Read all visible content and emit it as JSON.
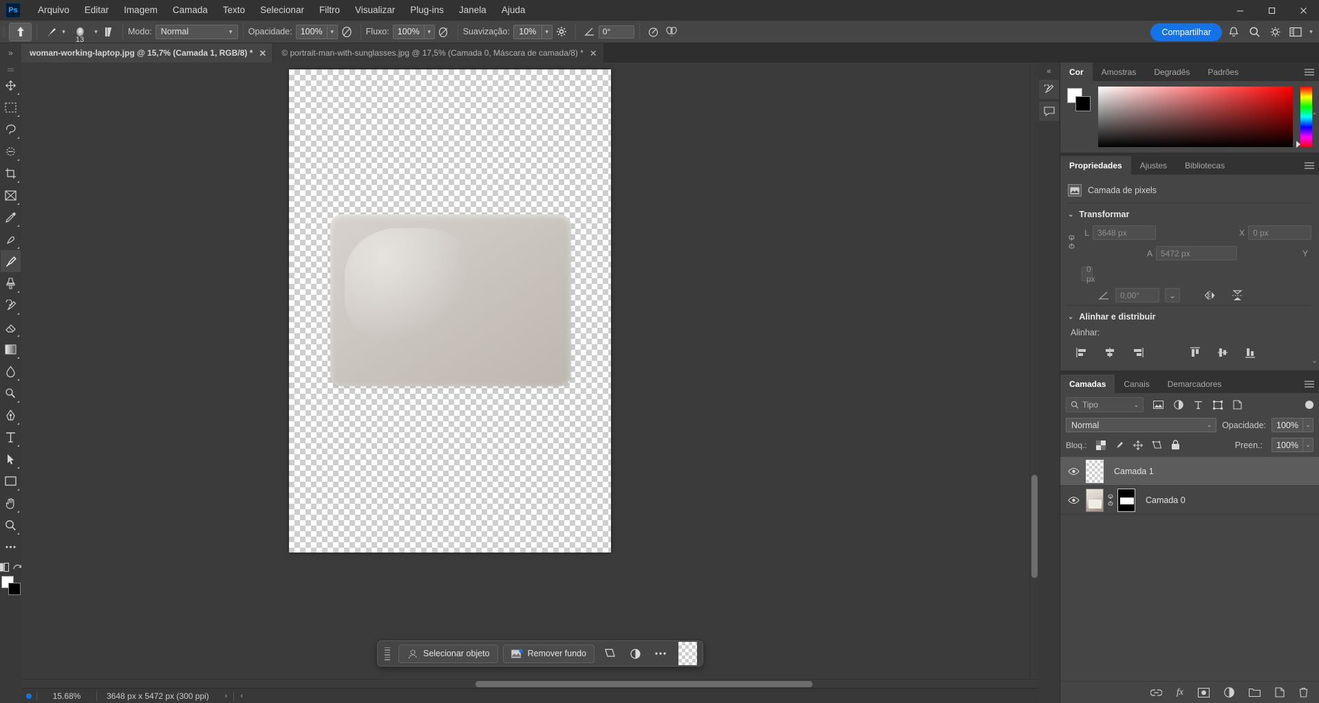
{
  "app": {
    "logo": "Ps",
    "title": "Adobe Photoshop"
  },
  "menubar": {
    "items": [
      {
        "label": "Arquivo"
      },
      {
        "label": "Editar"
      },
      {
        "label": "Imagem"
      },
      {
        "label": "Camada"
      },
      {
        "label": "Texto"
      },
      {
        "label": "Selecionar"
      },
      {
        "label": "Filtro"
      },
      {
        "label": "Visualizar"
      },
      {
        "label": "Plug-ins"
      },
      {
        "label": "Janela"
      },
      {
        "label": "Ajuda"
      }
    ],
    "window_controls": {
      "minimize": "─",
      "maximize": "☐",
      "close": "✕"
    }
  },
  "options_bar": {
    "brush_size": "13",
    "mode_label": "Modo:",
    "mode_value": "Normal",
    "opacity_label": "Opacidade:",
    "opacity_value": "100%",
    "flow_label": "Fluxo:",
    "flow_value": "100%",
    "smoothing_label": "Suavização:",
    "smoothing_value": "10%",
    "angle_value": "0°",
    "share_label": "Compartilhar"
  },
  "tabs": [
    {
      "label": "woman-working-laptop.jpg @ 15,7% (Camada 1, RGB/8) *",
      "active": true,
      "close": "✕"
    },
    {
      "label": "© portrait-man-with-sunglasses.jpg @ 17,5% (Camada 0, Máscara de camada/8) *",
      "active": false,
      "close": "✕"
    }
  ],
  "toolbar": {
    "tools": [
      {
        "name": "move-tool"
      },
      {
        "name": "marquee-tool"
      },
      {
        "name": "lasso-tool"
      },
      {
        "name": "object-selection-tool"
      },
      {
        "name": "crop-tool"
      },
      {
        "name": "frame-tool"
      },
      {
        "name": "eyedropper-tool"
      },
      {
        "name": "spot-healing-tool"
      },
      {
        "name": "brush-tool",
        "active": true
      },
      {
        "name": "clone-stamp-tool"
      },
      {
        "name": "history-brush-tool"
      },
      {
        "name": "eraser-tool"
      },
      {
        "name": "gradient-tool"
      },
      {
        "name": "blur-tool"
      },
      {
        "name": "dodge-tool"
      },
      {
        "name": "pen-tool"
      },
      {
        "name": "type-tool"
      },
      {
        "name": "path-selection-tool"
      },
      {
        "name": "rectangle-tool"
      },
      {
        "name": "hand-tool"
      },
      {
        "name": "zoom-tool"
      },
      {
        "name": "more-tools"
      }
    ]
  },
  "canvas": {
    "context_bar": {
      "select_subject": "Selecionar objeto",
      "remove_background": "Remover fundo",
      "transform_icon": "transform-icon",
      "adjust_icon": "adjustment-icon",
      "more_icon": "more-options-icon"
    }
  },
  "statusbar": {
    "zoom": "15.68%",
    "dimensions": "3648 px x 5472 px (300 ppi)",
    "arrow_right": "›",
    "arrow_left": "‹"
  },
  "color_panel": {
    "tabs": [
      {
        "label": "Cor",
        "active": true
      },
      {
        "label": "Amostras",
        "active": false
      },
      {
        "label": "Degradês",
        "active": false
      },
      {
        "label": "Padrões",
        "active": false
      }
    ],
    "foreground": "#ffffff",
    "background": "#000000"
  },
  "properties_panel": {
    "tabs": [
      {
        "label": "Propriedades",
        "active": true
      },
      {
        "label": "Ajustes",
        "active": false
      },
      {
        "label": "Bibliotecas",
        "active": false
      }
    ],
    "layer_type": "Camada de pixels",
    "transform": {
      "title": "Transformar",
      "w_label": "L",
      "w_value": "3648 px",
      "h_label": "A",
      "h_value": "5472 px",
      "x_label": "X",
      "x_value": "0 px",
      "y_label": "Y",
      "y_value": "0 px",
      "angle_value": "0,00°"
    },
    "align": {
      "title": "Alinhar e distribuir",
      "subtitle": "Alinhar:"
    }
  },
  "layers_panel": {
    "tabs": [
      {
        "label": "Camadas",
        "active": true
      },
      {
        "label": "Canais",
        "active": false
      },
      {
        "label": "Demarcadores",
        "active": false
      }
    ],
    "filter_label": "Tipo",
    "blend_mode": "Normal",
    "opacity_label": "Opacidade:",
    "opacity_value": "100%",
    "lock_label": "Bloq.:",
    "fill_label": "Preen.:",
    "fill_value": "100%",
    "layers": [
      {
        "name": "Camada 1",
        "selected": true,
        "thumb": "transparent",
        "visible": true
      },
      {
        "name": "Camada 0",
        "selected": false,
        "thumb": "photo-with-mask",
        "visible": true
      }
    ],
    "bottom_icons": [
      "link-icon",
      "fx-icon",
      "mask-icon",
      "adjustment-icon",
      "group-icon",
      "new-layer-icon",
      "delete-icon"
    ]
  }
}
